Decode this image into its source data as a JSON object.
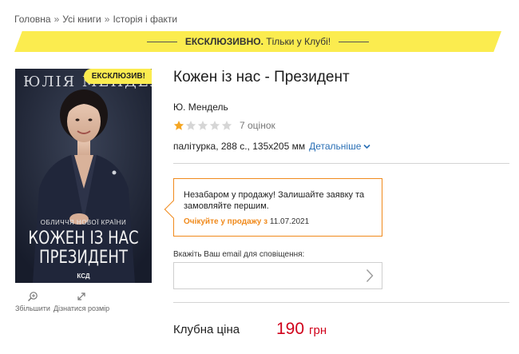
{
  "breadcrumb": {
    "items": [
      "Головна",
      "Усі книги",
      "Історія і факти"
    ],
    "separator": "»"
  },
  "banner": {
    "strong": "ЕКСКЛЮЗИВНО.",
    "text": " Тільки у Клубі!",
    "color": "#fbec4f"
  },
  "cover": {
    "badge": "ЕКСКЛЮЗИВ!",
    "author_top": "ЮЛІЯ МЕНДЕЛЬ",
    "subtitle": "ОБЛИЧЧЯ НОВОЇ КРАЇНИ",
    "title_line1": "КОЖЕН ІЗ НАС",
    "title_line2": "ПРЕЗИДЕНТ",
    "publisher": "КСД"
  },
  "cover_actions": {
    "zoom_label": "Збільшити",
    "size_label": "Дізнатися розмір"
  },
  "book": {
    "title": "Кожен із нас - Президент",
    "author": "Ю. Мендель",
    "rating": {
      "filled_stars": 1,
      "max_stars": 5,
      "count_text": "7 оцінок",
      "star_color": "#f5a623"
    },
    "specs": "палітурка, 288 с., 135x205 мм",
    "more_label": "Детальніше"
  },
  "notice": {
    "message": "Незабаром у продажу! Залишайте заявку та замовляйте першим.",
    "expected_label": "Очікуйте у продажу з",
    "expected_date": " 11.07.2021",
    "accent_color": "#f08a1c"
  },
  "email": {
    "label": "Вкажіть Ваш email для сповіщення:",
    "value": "",
    "placeholder": ""
  },
  "price": {
    "label": "Клубна ціна",
    "value": "190",
    "currency": "грн",
    "color": "#d0021b"
  }
}
